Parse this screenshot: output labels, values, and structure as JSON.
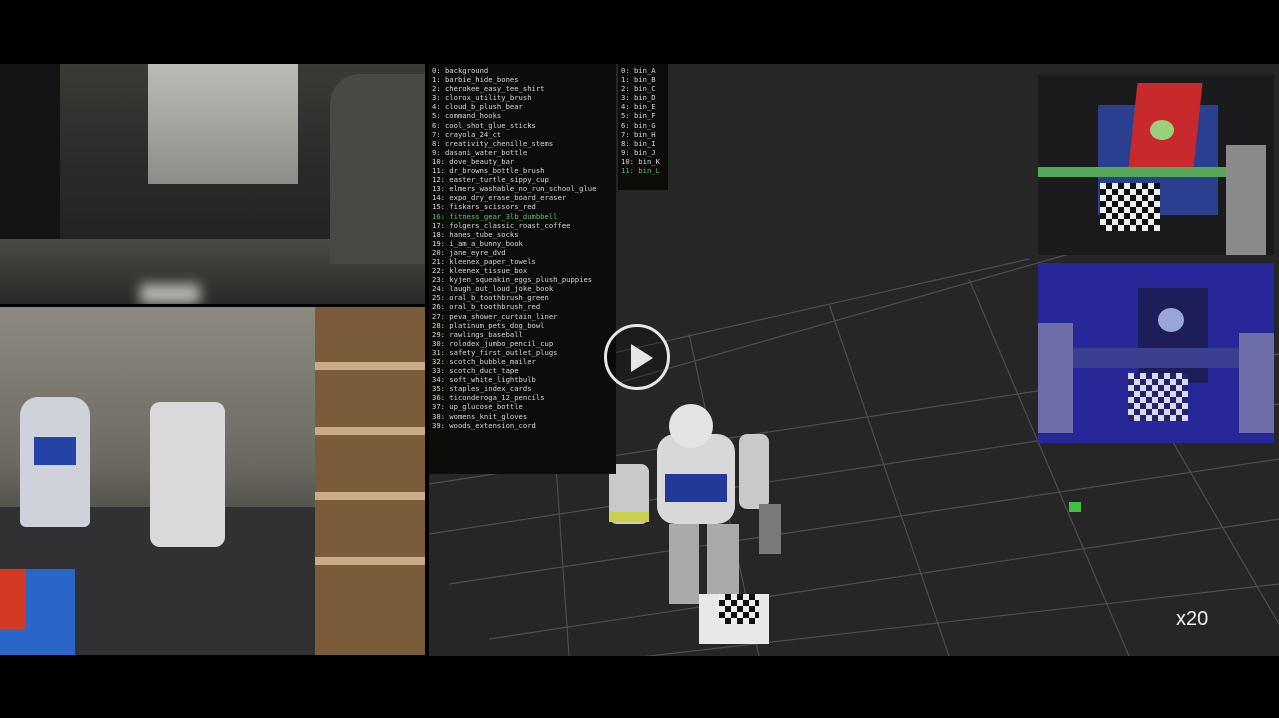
{
  "video": {
    "speed_label": "x20",
    "play_icon": "play-icon"
  },
  "object_list": [
    "0: background",
    "1: barbie_hide_bones",
    "2: cherokee_easy_tee_shirt",
    "3: clorox_utility_brush",
    "4: cloud_b_plush_bear",
    "5: command_hooks",
    "6: cool_shot_glue_sticks",
    "7: crayola_24_ct",
    "8: creativity_chenille_stems",
    "9: dasani_water_bottle",
    "10: dove_beauty_bar",
    "11: dr_browns_bottle_brush",
    "12: easter_turtle_sippy_cup",
    "13: elmers_washable_no_run_school_glue",
    "14: expo_dry_erase_board_eraser",
    "15: fiskars_scissors_red",
    "16: fitness_gear_3lb_dumbbell",
    "17: folgers_classic_roast_coffee",
    "18: hanes_tube_socks",
    "19: i_am_a_bunny_book",
    "20: jane_eyre_dvd",
    "21: kleenex_paper_towels",
    "22: kleenex_tissue_box",
    "23: kyjen_squeakin_eggs_plush_puppies",
    "24: laugh_out_loud_joke_book",
    "25: oral_b_toothbrush_green",
    "26: oral_b_toothbrush_red",
    "27: peva_shower_curtain_liner",
    "28: platinum_pets_dog_bowl",
    "29: rawlings_baseball",
    "30: rolodex_jumbo_pencil_cup",
    "31: safety_first_outlet_plugs",
    "32: scotch_bubble_mailer",
    "33: scotch_duct_tape",
    "34: soft_white_lightbulb",
    "35: staples_index_cards",
    "36: ticonderoga_12_pencils",
    "37: up_glucose_bottle",
    "38: womens_knit_gloves",
    "39: woods_extension_cord"
  ],
  "object_list_highlight": "16: fitness_gear_3lb_dumbbell",
  "index_list": [
    "0: bin_A",
    "1: bin_B",
    "2: bin_C",
    "3: bin_D",
    "4: bin_E",
    "5: bin_F",
    "6: bin_G",
    "7: bin_H",
    "8: bin_I",
    "9: bin_J",
    "10: bin_K",
    "11: bin_L"
  ],
  "index_list_highlight": "11: bin_L",
  "colors": {
    "highlight": "#58c070",
    "depth_tint": "#27279a",
    "grid": "#5a5a5a"
  }
}
